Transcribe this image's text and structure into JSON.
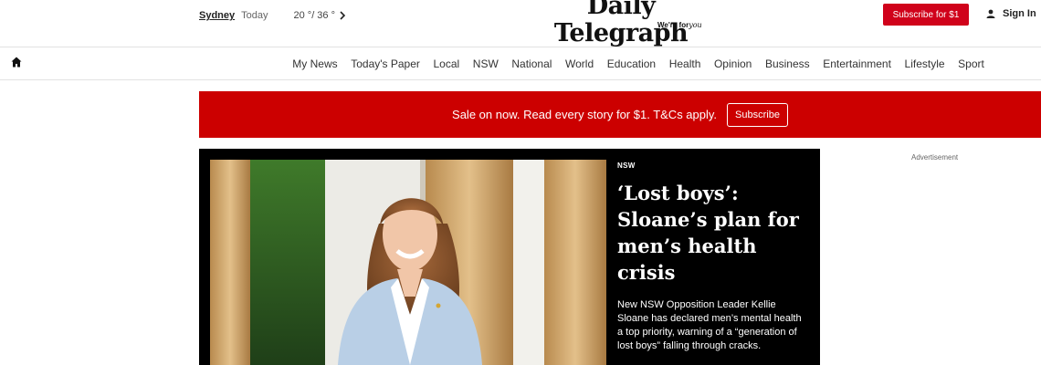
{
  "header": {
    "city": "Sydney",
    "today": "Today",
    "temperature": "20 °/ 36 °",
    "masthead_title": "Daily Telegraph",
    "masthead_tag_prefix": "We're for",
    "masthead_tag_script": "you",
    "subscribe_label": "Subscribe for $1",
    "signin_label": "Sign In"
  },
  "nav": {
    "items": [
      "My News",
      "Today's Paper",
      "Local",
      "NSW",
      "National",
      "World",
      "Education",
      "Health",
      "Opinion",
      "Business",
      "Entertainment",
      "Lifestyle",
      "Sport"
    ]
  },
  "promo": {
    "text": "Sale on now. Read every story for $1. T&Cs apply.",
    "button_label": "Subscribe"
  },
  "hero": {
    "kicker": "NSW",
    "headline": "‘Lost boys’: Sloane’s plan for men’s health crisis",
    "standfirst": "New NSW Opposition Leader Kellie Sloane has declared men’s mental health a top priority, warning of a “generation of lost boys” falling through cracks."
  },
  "sidebar": {
    "advert_label": "Advertisement"
  },
  "icons": {
    "home": "home-icon",
    "user": "user-icon",
    "chevron": "chevron-right-icon"
  },
  "colors": {
    "brand_red": "#cc0000",
    "hero_bg": "#000000"
  }
}
